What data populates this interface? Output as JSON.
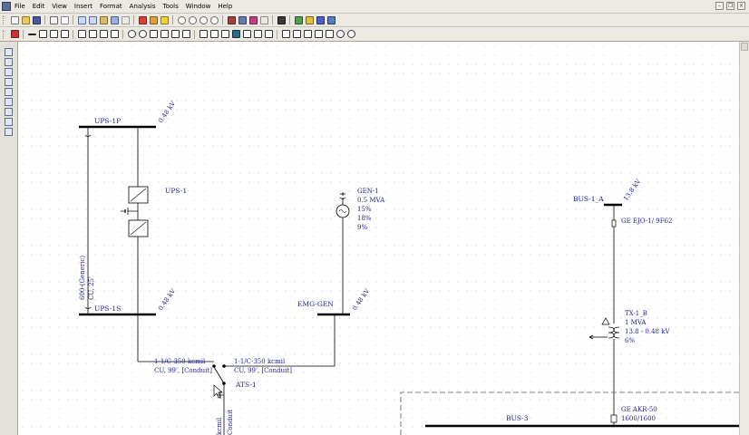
{
  "menubar": {
    "items": [
      "File",
      "Edit",
      "View",
      "Insert",
      "Format",
      "Analysis",
      "Tools",
      "Window",
      "Help"
    ]
  },
  "diagram": {
    "ups_1p": {
      "name": "UPS-1P",
      "kv": "0.48 kV"
    },
    "ups_1": {
      "name": "UPS-1"
    },
    "ups_cable": {
      "size": "600-(Generic)",
      "spec": "CU, 25'"
    },
    "ups_1s": {
      "name": "UPS-1S",
      "kv": "0.48 kV"
    },
    "gen_1": {
      "name": "GEN-1",
      "rating": "0.5 MVA",
      "line1": "15%",
      "line2": "18%",
      "line3": "9%"
    },
    "emg_gen": {
      "name": "EMG-GEN",
      "kv": "0.48 kV"
    },
    "cable_left": {
      "size": "1-1/C-350 kcmil",
      "spec": "CU, 99', [Conduit]"
    },
    "cable_right": {
      "size": "1-1/C-350 kcmil",
      "spec": "CU, 99', [Conduit]"
    },
    "ats_1": {
      "name": "ATS-1"
    },
    "cable_bottom": {
      "size": "kcmil",
      "spec": "Conduit"
    },
    "bus_1a": {
      "name": "BUS-1_A",
      "kv": "13.8 kV"
    },
    "ge_fuse": {
      "name": "GE EJO-1/ 9F62"
    },
    "tx_1b": {
      "name": "TX-1_B",
      "rating": "1 MVA",
      "voltage": "13.8 - 0.48 kV",
      "impedance": "6%"
    },
    "ge_breaker": {
      "name": "GE AKR-50",
      "rating": "1600/1600"
    },
    "bus_3": {
      "name": "BUS-3"
    }
  }
}
